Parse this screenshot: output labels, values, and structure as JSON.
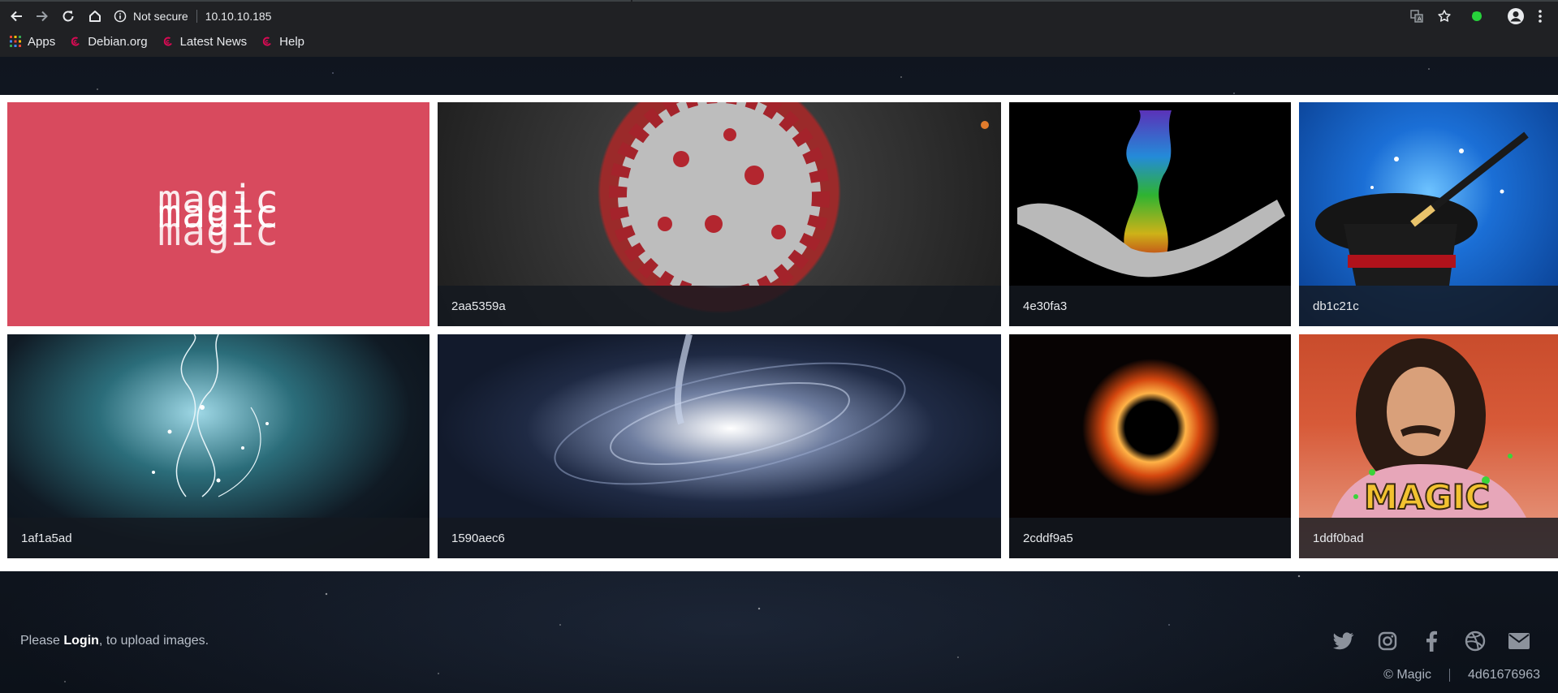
{
  "browser": {
    "security_label": "Not secure",
    "url": "10.10.10.185",
    "bookmarks": [
      {
        "label": "Apps",
        "icon": "apps-grid-icon"
      },
      {
        "label": "Debian.org",
        "icon": "debian-icon"
      },
      {
        "label": "Latest News",
        "icon": "debian-icon"
      },
      {
        "label": "Help",
        "icon": "debian-icon"
      }
    ]
  },
  "gallery": {
    "logo_text": "magic",
    "tiles": [
      {
        "caption": "2aa5359a",
        "image": "coronavirus"
      },
      {
        "caption": "4e30fa3",
        "image": "rainbow-smoke-hand"
      },
      {
        "caption": "db1c21c",
        "image": "magic-hat-wand"
      },
      {
        "caption": "1af1a5ad",
        "image": "magic-sparkles"
      },
      {
        "caption": "1590aec6",
        "image": "galaxy"
      },
      {
        "caption": "2cddf9a5",
        "image": "black-hole"
      },
      {
        "caption": "1ddf0bad",
        "image": "magic-meme"
      }
    ]
  },
  "footer": {
    "prefix": "Please ",
    "login_label": "Login",
    "suffix": ", to upload images.",
    "social": [
      "twitter-icon",
      "instagram-icon",
      "facebook-icon",
      "dribbble-icon",
      "mail-icon"
    ],
    "copyright": "© Magic",
    "hash": "4d61676963"
  },
  "colors": {
    "logo_bg": "#d84a5e",
    "chrome_bg": "#202124",
    "frame": "#ffffff"
  }
}
